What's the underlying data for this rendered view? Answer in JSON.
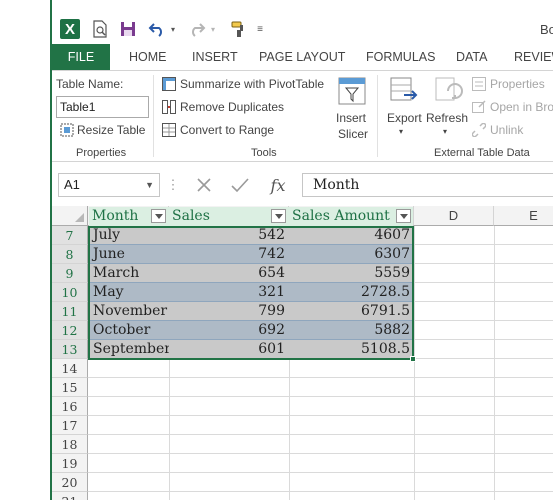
{
  "qat": {
    "icons": [
      "excel-logo",
      "print-preview-icon",
      "save-icon",
      "undo-icon",
      "redo-icon",
      "format-painter-icon",
      "customize-qat-icon"
    ],
    "title_partial": "Bo"
  },
  "ribbon_tabs": [
    "FILE",
    "HOME",
    "INSERT",
    "PAGE LAYOUT",
    "FORMULAS",
    "DATA",
    "REVIEW"
  ],
  "ribbon": {
    "properties": {
      "table_name_label": "Table Name:",
      "table_name_value": "Table1",
      "resize_label": "Resize Table",
      "group_label": "Properties"
    },
    "tools": {
      "pivot_label": "Summarize with PivotTable",
      "dupes_label": "Remove Duplicates",
      "range_label": "Convert to Range",
      "slicer_label_1": "Insert",
      "slicer_label_2": "Slicer",
      "group_label": "Tools"
    },
    "external": {
      "export_label": "Export",
      "refresh_label": "Refresh",
      "properties_label": "Properties",
      "open_label": "Open in Bro",
      "unlink_label": "Unlink",
      "group_label": "External Table Data"
    }
  },
  "formula_bar": {
    "name_box": "A1",
    "fx_label": "fx",
    "content": "Month"
  },
  "grid": {
    "columns": [
      "A",
      "B",
      "C",
      "D",
      "E"
    ],
    "header_row": "",
    "table_headers": [
      "Month",
      "Sales",
      "Sales Amount"
    ],
    "rows": [
      {
        "num": "7",
        "month": "July",
        "sales": "542",
        "amount": "4607"
      },
      {
        "num": "8",
        "month": "June",
        "sales": "742",
        "amount": "6307"
      },
      {
        "num": "9",
        "month": "March",
        "sales": "654",
        "amount": "5559"
      },
      {
        "num": "10",
        "month": "May",
        "sales": "321",
        "amount": "2728.5"
      },
      {
        "num": "11",
        "month": "November",
        "sales": "799",
        "amount": "6791.5"
      },
      {
        "num": "12",
        "month": "October",
        "sales": "692",
        "amount": "5882"
      },
      {
        "num": "13",
        "month": "September",
        "sales": "601",
        "amount": "5108.5"
      }
    ],
    "empty_rows": [
      "14",
      "15",
      "16",
      "17",
      "18",
      "19",
      "20",
      "21"
    ]
  },
  "colors": {
    "excel_green": "#217346",
    "header_fill": "#dbefe2",
    "row_fill_a": "#c9c9c9",
    "row_fill_b": "#aebac6"
  }
}
